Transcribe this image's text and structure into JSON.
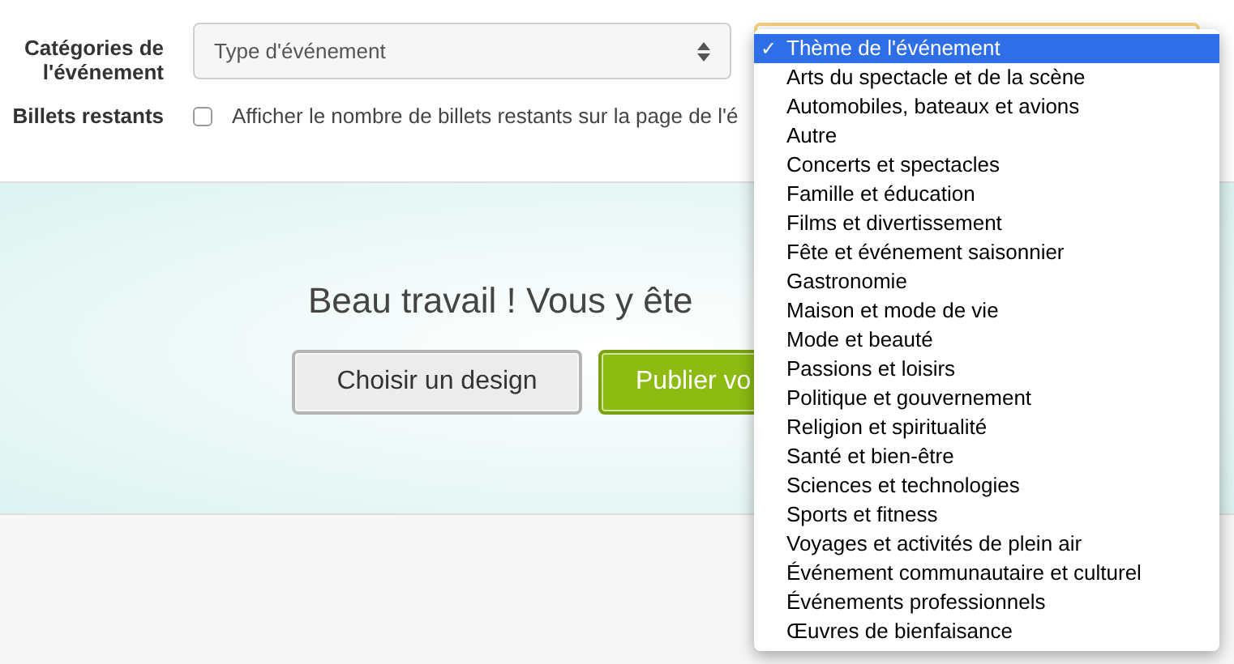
{
  "form": {
    "fields": [
      {
        "kind": "select",
        "label": "Catégories de l'événement",
        "value": "Type d'événement"
      },
      {
        "kind": "checkbox",
        "label": "Billets restants",
        "text": "Afficher le nombre de billets restants sur la page de l'é",
        "checked": false
      }
    ]
  },
  "hero": {
    "heading": "Beau travail ! Vous y ête",
    "buttons": [
      {
        "kind": "secondary",
        "label": "Choisir un design"
      },
      {
        "kind": "primary",
        "label": "Publier vo"
      }
    ]
  },
  "dropdown": {
    "options": [
      {
        "label": "Thème de l'événement",
        "selected": true
      },
      {
        "label": "Arts du spectacle et de la scène",
        "selected": false
      },
      {
        "label": "Automobiles, bateaux et avions",
        "selected": false
      },
      {
        "label": "Autre",
        "selected": false
      },
      {
        "label": "Concerts et spectacles",
        "selected": false
      },
      {
        "label": "Famille et éducation",
        "selected": false
      },
      {
        "label": "Films et divertissement",
        "selected": false
      },
      {
        "label": "Fête et événement saisonnier",
        "selected": false
      },
      {
        "label": "Gastronomie",
        "selected": false
      },
      {
        "label": "Maison et mode de vie",
        "selected": false
      },
      {
        "label": "Mode et beauté",
        "selected": false
      },
      {
        "label": "Passions et loisirs",
        "selected": false
      },
      {
        "label": "Politique et gouvernement",
        "selected": false
      },
      {
        "label": "Religion et spiritualité",
        "selected": false
      },
      {
        "label": "Santé et bien-être",
        "selected": false
      },
      {
        "label": "Sciences et technologies",
        "selected": false
      },
      {
        "label": "Sports et fitness",
        "selected": false
      },
      {
        "label": "Voyages et activités de plein air",
        "selected": false
      },
      {
        "label": "Événement communautaire et culturel",
        "selected": false
      },
      {
        "label": "Événements professionnels",
        "selected": false
      },
      {
        "label": "Œuvres de bienfaisance",
        "selected": false
      }
    ],
    "check_mark": "✓"
  }
}
